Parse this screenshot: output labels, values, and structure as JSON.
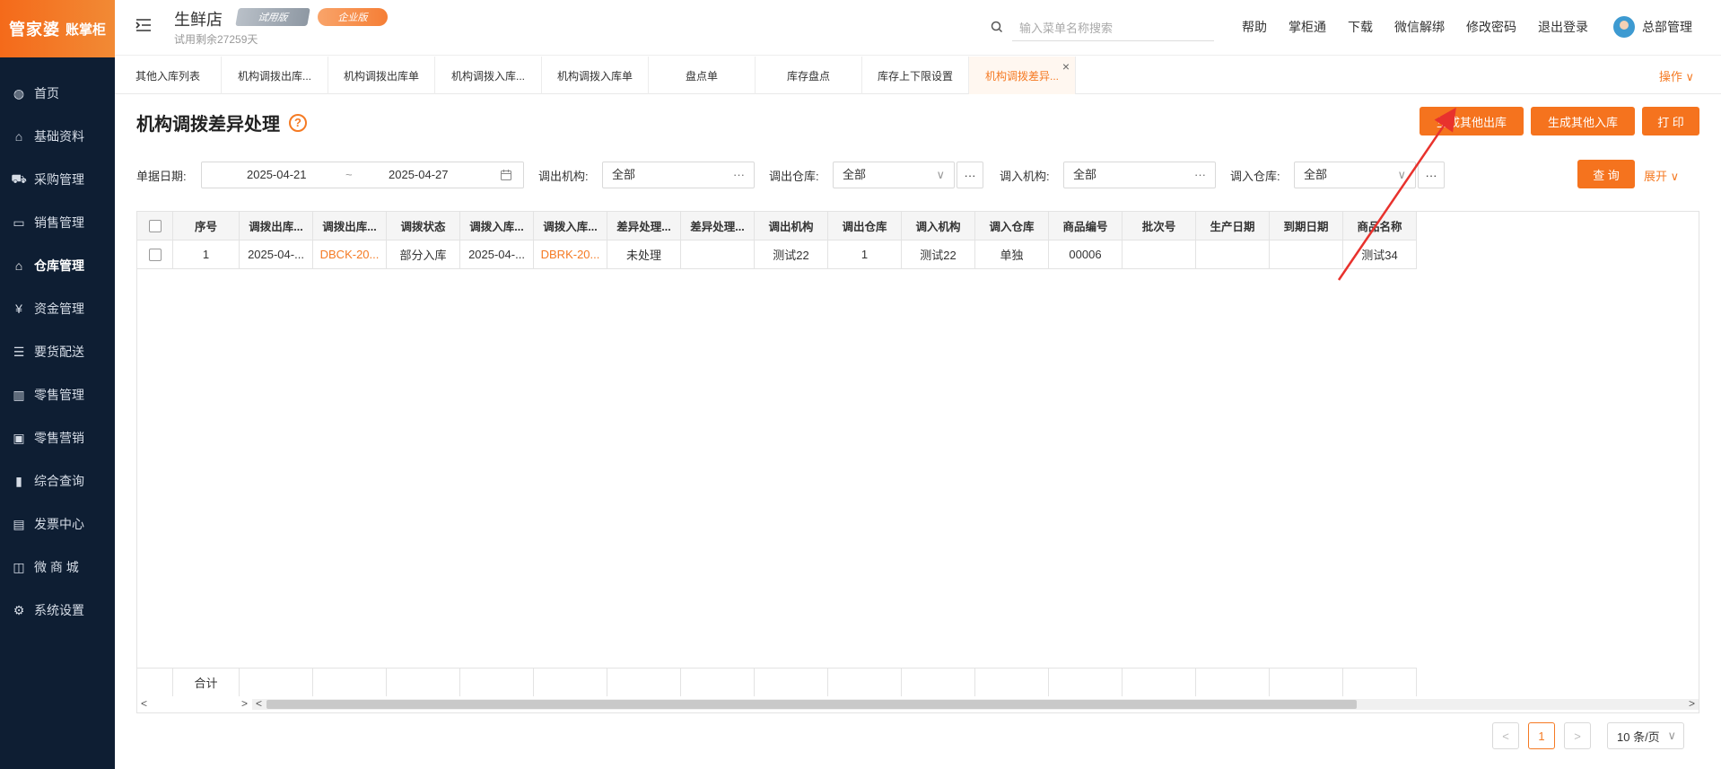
{
  "app": {
    "logo_main": "管家婆",
    "logo_sub": "账掌柜",
    "store_name": "生鲜店",
    "trial_badge": "试用版",
    "edition_badge": "企业版",
    "trial_remaining": "试用剩余27259天"
  },
  "search": {
    "placeholder": "输入菜单名称搜索"
  },
  "top_links": [
    "帮助",
    "掌柜通",
    "下载",
    "微信解绑",
    "修改密码",
    "退出登录"
  ],
  "user": {
    "name": "总部管理"
  },
  "sidebar": {
    "items": [
      {
        "label": "首页",
        "icon": "globe-icon"
      },
      {
        "label": "基础资料",
        "icon": "home-icon"
      },
      {
        "label": "采购管理",
        "icon": "cart-icon"
      },
      {
        "label": "销售管理",
        "icon": "sales-icon"
      },
      {
        "label": "仓库管理",
        "icon": "warehouse-icon",
        "active": true
      },
      {
        "label": "资金管理",
        "icon": "money-icon"
      },
      {
        "label": "要货配送",
        "icon": "list-icon"
      },
      {
        "label": "零售管理",
        "icon": "chart-icon"
      },
      {
        "label": "零售营销",
        "icon": "gift-icon"
      },
      {
        "label": "综合查询",
        "icon": "bar-chart-icon"
      },
      {
        "label": "发票中心",
        "icon": "invoice-icon"
      },
      {
        "label": "微 商 城",
        "icon": "bag-icon"
      },
      {
        "label": "系统设置",
        "icon": "gear-icon"
      }
    ]
  },
  "tabs": {
    "items": [
      "其他入库列表",
      "机构调拨出库...",
      "机构调拨出库单",
      "机构调拨入库...",
      "机构调拨入库单",
      "盘点单",
      "库存盘点",
      "库存上下限设置",
      "机构调拨差异..."
    ],
    "active_index": 8,
    "op_menu": "操作 ∨"
  },
  "page": {
    "title": "机构调拨差异处理",
    "buttons": {
      "gen_out": "生成其他出库",
      "gen_in": "生成其他入库",
      "print": "打 印",
      "query": "查 询"
    },
    "expand": "展开"
  },
  "filters": {
    "date_label": "单据日期:",
    "date_start": "2025-04-21",
    "date_sep": "~",
    "date_end": "2025-04-27",
    "out_org_label": "调出机构:",
    "out_org_value": "全部",
    "out_wh_label": "调出仓库:",
    "out_wh_value": "全部",
    "in_org_label": "调入机构:",
    "in_org_value": "全部",
    "in_wh_label": "调入仓库:",
    "in_wh_value": "全部"
  },
  "table": {
    "headers": [
      "序号",
      "调拨出库...",
      "调拨出库...",
      "调拨状态",
      "调拨入库...",
      "调拨入库...",
      "差异处理...",
      "差异处理...",
      "调出机构",
      "调出仓库",
      "调入机构",
      "调入仓库",
      "商品编号",
      "批次号",
      "生产日期",
      "到期日期",
      "商品名称"
    ],
    "rows": [
      [
        "1",
        "2025-04-...",
        "DBCK-20...",
        "部分入库",
        "2025-04-...",
        "DBRK-20...",
        "未处理",
        "",
        "测试22",
        "1",
        "测试22",
        "单独",
        "00006",
        "",
        "",
        "",
        "测试34"
      ]
    ],
    "footer_label": "合计"
  },
  "pagination": {
    "prev": "<",
    "current": "1",
    "next": ">",
    "page_size": "10 条/页"
  },
  "colors": {
    "accent": "#f5731e",
    "sidebar_bg": "#0e1e33",
    "annotation": "#e8322d"
  }
}
